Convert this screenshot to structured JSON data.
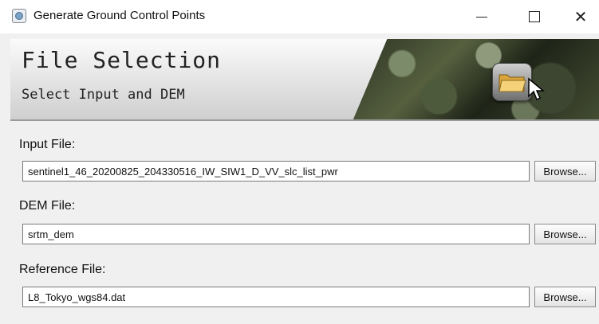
{
  "window": {
    "title": "Generate Ground Control Points",
    "controls": [
      "minimize-icon",
      "maximize-icon",
      "close-icon"
    ]
  },
  "header": {
    "title": "File Selection",
    "subtitle": "Select Input and DEM"
  },
  "fields": [
    {
      "label": "Input File:",
      "value": "sentinel1_46_20200825_204330516_IW_SIW1_D_VV_slc_list_pwr",
      "button": "Browse..."
    },
    {
      "label": "DEM File:",
      "value": "srtm_dem",
      "button": "Browse..."
    },
    {
      "label": "Reference File:",
      "value": "L8_Tokyo_wgs84.dat",
      "button": "Browse..."
    }
  ]
}
